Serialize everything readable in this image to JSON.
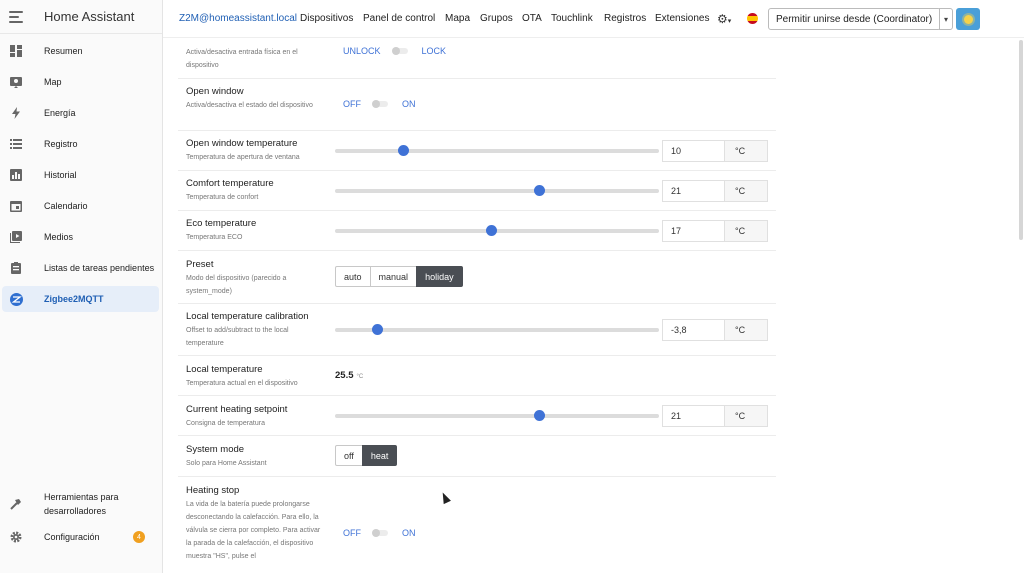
{
  "sidebar": {
    "title": "Home Assistant",
    "items": [
      {
        "label": "Resumen",
        "icon": "dashboard-icon"
      },
      {
        "label": "Map",
        "icon": "map-icon"
      },
      {
        "label": "Energía",
        "icon": "lightning-icon"
      },
      {
        "label": "Registro",
        "icon": "list-icon"
      },
      {
        "label": "Historial",
        "icon": "chart-icon"
      },
      {
        "label": "Calendario",
        "icon": "calendar-icon"
      },
      {
        "label": "Medios",
        "icon": "media-icon"
      },
      {
        "label": "Listas de tareas pendientes",
        "icon": "clipboard-icon"
      },
      {
        "label": "Zigbee2MQTT",
        "icon": "zigbee-icon",
        "active": true
      }
    ],
    "bottom": [
      {
        "label": "Herramientas para desarrolladores",
        "icon": "hammer-icon"
      },
      {
        "label": "Configuración",
        "icon": "gear-icon",
        "badge": "4"
      }
    ]
  },
  "topnav": {
    "brand": "Z2M@homeassistant.local",
    "links": [
      "Dispositivos",
      "Panel de control",
      "Mapa",
      "Grupos",
      "OTA",
      "Touchlink",
      "Registros",
      "Extensiones"
    ],
    "settings_icon": "gear-icon",
    "language_icon": "spain-flag-icon",
    "permit_join": "Permitir unirse desde (Coordinator)",
    "accent": "#4a9fd8"
  },
  "rows": {
    "child_lock": {
      "desc": "Activa/desactiva entrada física en el dispositivo",
      "off": "UNLOCK",
      "on": "LOCK"
    },
    "open_window": {
      "title": "Open window",
      "desc": "Activa/desactiva el estado del dispositivo",
      "off": "OFF",
      "on": "ON"
    },
    "open_window_temp": {
      "title": "Open window temperature",
      "desc": "Temperatura de apertura de ventana",
      "value": "10",
      "unit": "°C",
      "fraction": 0.21
    },
    "comfort_temp": {
      "title": "Comfort temperature",
      "desc": "Temperatura de confort",
      "value": "21",
      "unit": "°C",
      "fraction": 0.63
    },
    "eco_temp": {
      "title": "Eco temperature",
      "desc": "Temperatura ECO",
      "value": "17",
      "unit": "°C",
      "fraction": 0.48
    },
    "preset": {
      "title": "Preset",
      "desc": "Modo del dispositivo (parecido a system_mode)",
      "options": [
        "auto",
        "manual",
        "holiday"
      ],
      "selected": "holiday"
    },
    "local_temp_cal": {
      "title": "Local temperature calibration",
      "desc": "Offset to add/subtract to the local temperature",
      "value": "-3,8",
      "unit": "°C",
      "fraction": 0.13
    },
    "local_temp": {
      "title": "Local temperature",
      "desc": "Temperatura actual en el dispositivo",
      "value": "25.5",
      "unit": "°C"
    },
    "heating_setpoint": {
      "title": "Current heating setpoint",
      "desc": "Consigna de temperatura",
      "value": "21",
      "unit": "°C",
      "fraction": 0.63
    },
    "system_mode": {
      "title": "System mode",
      "desc": "Solo para Home Assistant",
      "options": [
        "off",
        "heat"
      ],
      "selected": "heat"
    },
    "heating_stop": {
      "title": "Heating stop",
      "desc": "La vida de la batería puede prolongarse desconectando la calefacción. Para ello, la válvula se cierra por completo. Para activar la parada de la calefacción, el dispositivo muestra \"HS\", pulse el",
      "off": "OFF",
      "on": "ON"
    }
  }
}
